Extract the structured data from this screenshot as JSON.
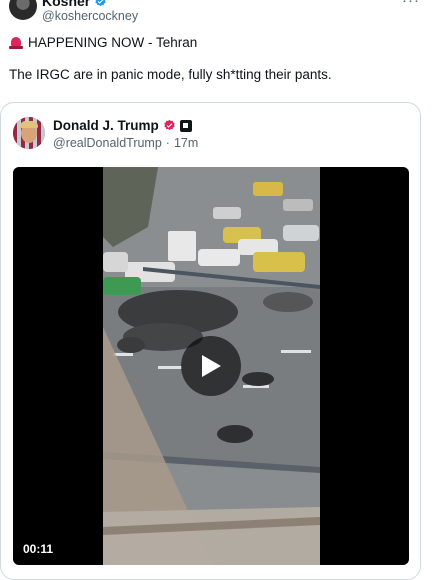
{
  "tweet": {
    "author_name": "Kosher",
    "author_handle": "@koshercockney",
    "more": "···",
    "line1": "HAPPENING NOW - Tehran",
    "line2": "The IRGC are in panic mode, fully sh*tting their pants."
  },
  "quoted": {
    "author_name": "Donald J. Trump",
    "author_handle": "@realDonaldTrump",
    "separator": "·",
    "time_ago": "17m",
    "video": {
      "timestamp": "00:11"
    }
  },
  "colors": {
    "verified_blue": "#1d9bf0",
    "verified_red": "#e0245e",
    "secondary_text": "#536471"
  },
  "icons": {
    "verified": "verified-badge-icon",
    "siren": "siren-emoji-icon",
    "affiliate": "affiliate-badge-icon",
    "play": "play-icon",
    "more": "more-icon"
  }
}
